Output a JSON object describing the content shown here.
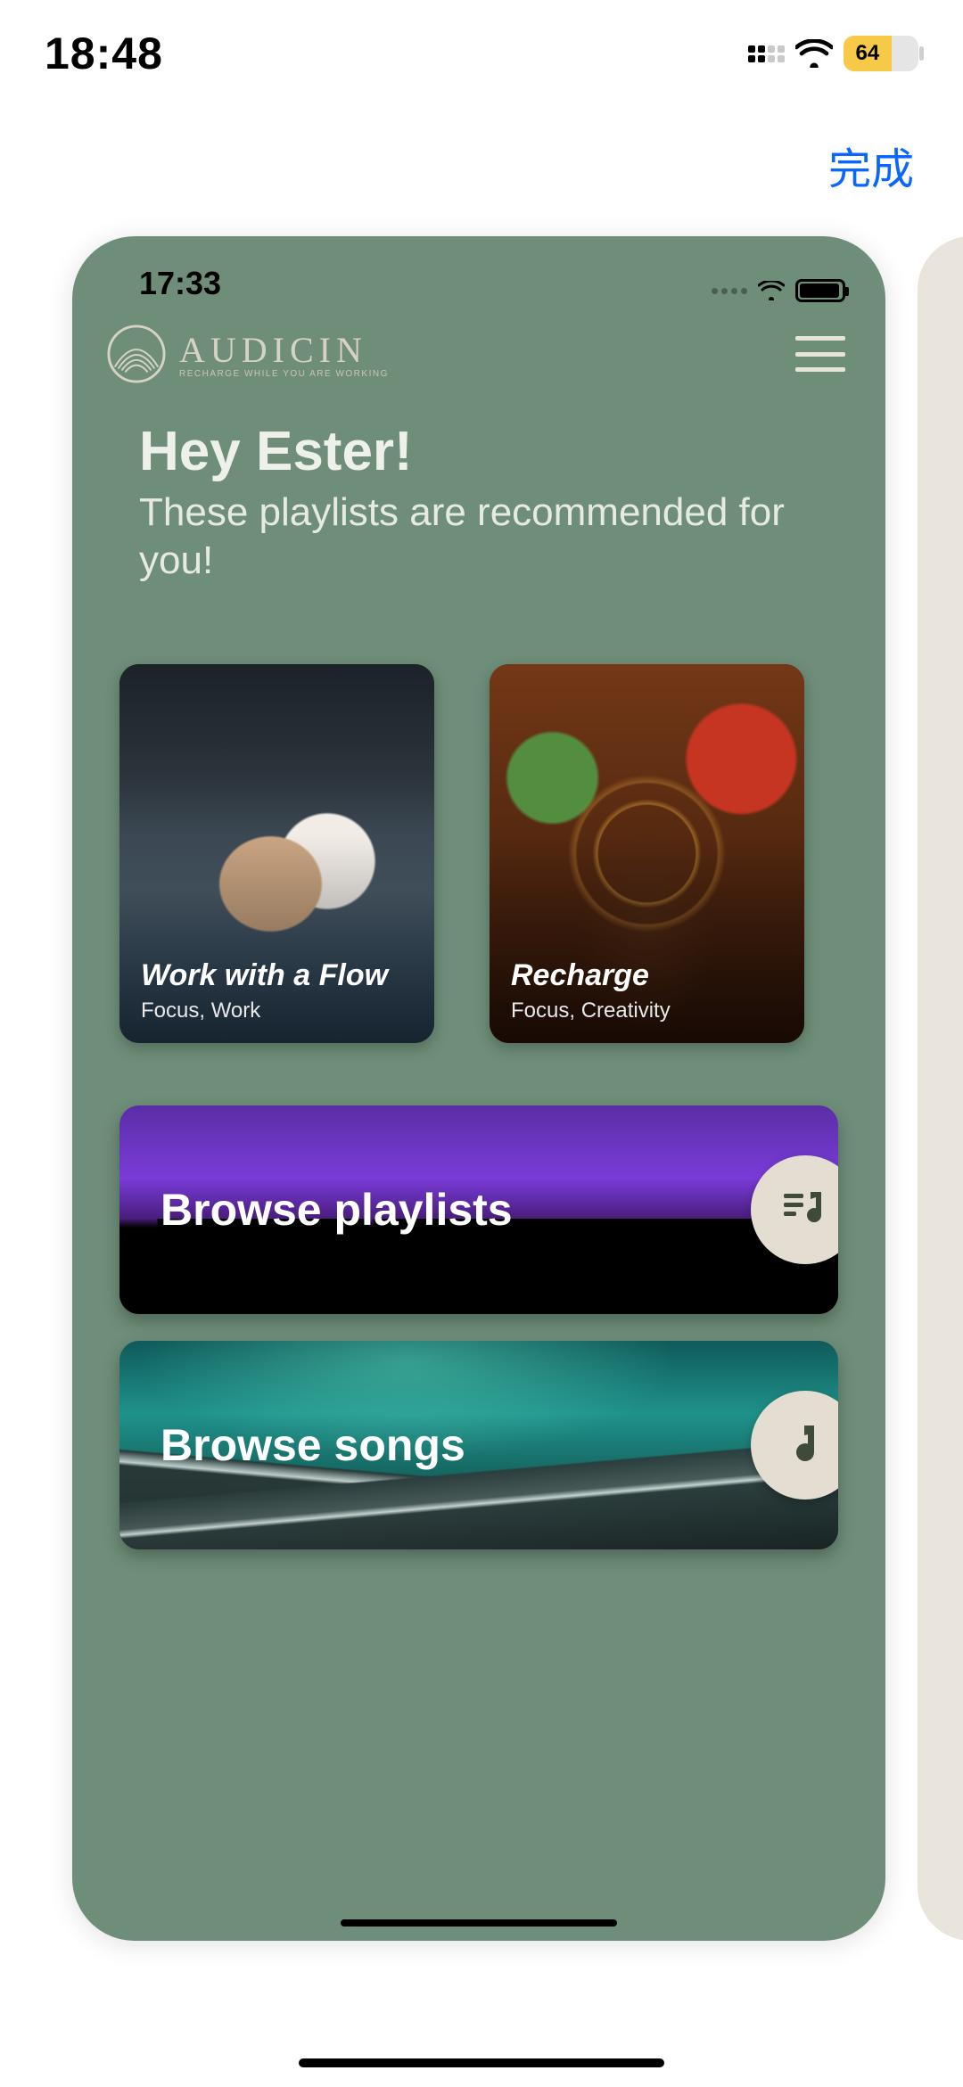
{
  "outer_status": {
    "time": "18:48",
    "battery": "64",
    "battery_pct": 64
  },
  "done_label": "完成",
  "inner_status": {
    "time": "17:33"
  },
  "brand": {
    "name": "AUDICIN",
    "tagline": "RECHARGE WHILE YOU ARE WORKING"
  },
  "greeting": {
    "title": "Hey Ester!",
    "subtitle": "These playlists are recommended for you!"
  },
  "cards": [
    {
      "title": "Work with a Flow",
      "tags": "Focus, Work"
    },
    {
      "title": "Recharge",
      "tags": "Focus, Creativity"
    }
  ],
  "banners": {
    "playlists": "Browse playlists",
    "songs": "Browse songs"
  }
}
